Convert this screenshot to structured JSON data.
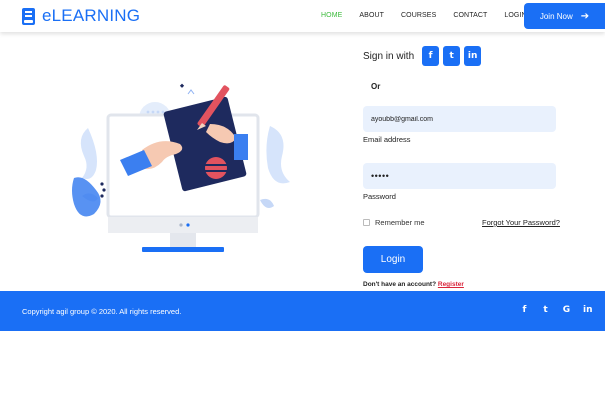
{
  "header": {
    "logo_text": "eLEARNING",
    "nav": [
      "HOME",
      "ABOUT",
      "COURSES",
      "CONTACT",
      "LOGIN"
    ],
    "active_nav": "HOME",
    "join_label": "Join Now",
    "join_icon": "arrow-right-icon"
  },
  "signin": {
    "label": "Sign in with",
    "social": [
      {
        "name": "facebook",
        "glyph": "f"
      },
      {
        "name": "twitter",
        "glyph": "t"
      },
      {
        "name": "linkedin",
        "glyph": "in"
      }
    ],
    "or_label": "Or"
  },
  "form": {
    "email_value": "ayoubb@gmail.com",
    "email_label": "Email address",
    "password_value": "•••••",
    "password_label": "Password",
    "remember_label": "Remember me",
    "remember_checked": false,
    "forgot_label": "Forgot Your Password?",
    "login_label": "Login",
    "no_account_text": "Don't have an account?",
    "register_label": "Register"
  },
  "footer": {
    "copyright": "Copyright agil group © 2020. All rights reserved.",
    "social": [
      {
        "name": "facebook",
        "glyph": "f"
      },
      {
        "name": "twitter",
        "glyph": "t"
      },
      {
        "name": "google",
        "glyph": "G"
      },
      {
        "name": "linkedin",
        "glyph": "in"
      }
    ]
  },
  "colors": {
    "primary": "#1a6ff5",
    "nav_active": "#3dbb3d",
    "register_link": "#d9243a",
    "input_bg": "#e9f1fd"
  }
}
